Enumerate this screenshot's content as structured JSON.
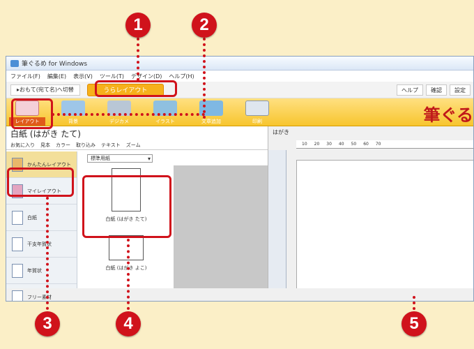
{
  "window": {
    "title": "筆ぐるめ for Windows",
    "menu": [
      "ファイル(F)",
      "編集(E)",
      "表示(V)",
      "ツール(T)",
      "デザイン(D)",
      "ヘルプ(H)"
    ]
  },
  "toolbar": {
    "back_label": "▸おもて(宛て名)へ切替",
    "active_tab": "うらレイアウト",
    "right_buttons": [
      "ヘルプ",
      "確認",
      "設定"
    ]
  },
  "ribbon": {
    "buttons": [
      {
        "label": "レイアウト",
        "icon": "layout-icon"
      },
      {
        "label": "背景",
        "icon": "background-icon"
      },
      {
        "label": "デジカメ",
        "icon": "camera-icon"
      },
      {
        "label": "イラスト",
        "icon": "illustration-icon"
      },
      {
        "label": "文章追加",
        "icon": "text-add-icon"
      },
      {
        "label": "印刷",
        "icon": "printer-icon"
      }
    ],
    "brand": "筆ぐる"
  },
  "left_panel": {
    "title": "白紙 (はがき たて)",
    "tools": [
      "お気に入り",
      "見本",
      "カラー",
      "取り込み",
      "テキスト",
      "ズーム"
    ],
    "sidebar": [
      {
        "label": "かんたんレイアウト",
        "active": true
      },
      {
        "label": "マイレイアウト",
        "active": false
      },
      {
        "label": "白紙",
        "active": false
      },
      {
        "label": "干支年賀状",
        "active": false
      },
      {
        "label": "年賀状",
        "active": false
      },
      {
        "label": "フリー素材",
        "active": false
      }
    ],
    "filter_value": "標準用紙",
    "thumbnails": [
      {
        "label": "白紙 (はがき たて)"
      },
      {
        "label": "白紙 (はがき よこ)"
      }
    ]
  },
  "right_panel": {
    "title": "はがき",
    "ruler_marks": [
      "10",
      "20",
      "30",
      "40",
      "50",
      "60",
      "70"
    ]
  },
  "callouts": [
    "1",
    "2",
    "3",
    "4",
    "5"
  ],
  "colors": {
    "accent": "#d0121b",
    "ribbon": "#f7c52e",
    "tab": "#f6b11b"
  }
}
